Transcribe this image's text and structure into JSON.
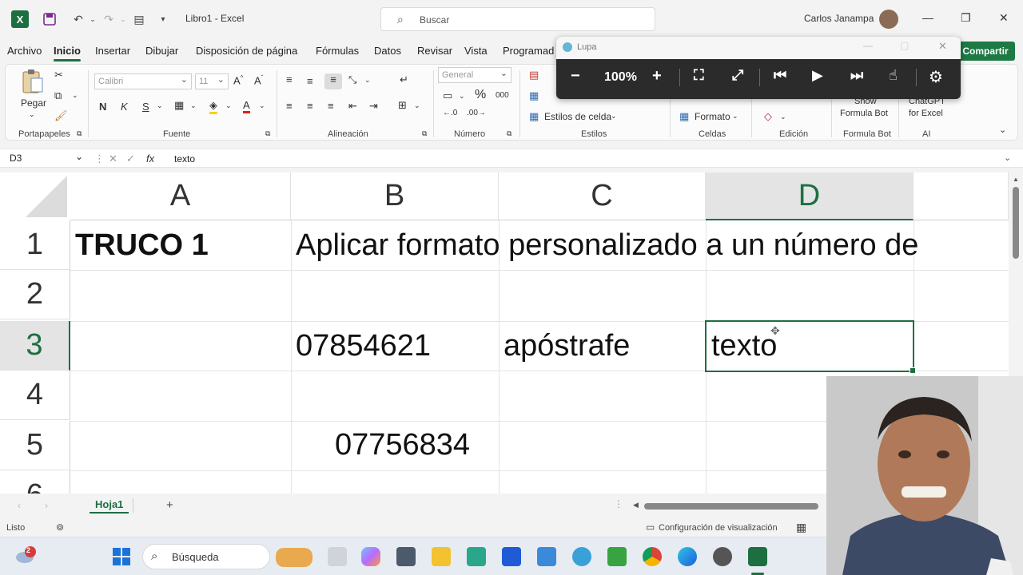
{
  "titlebar": {
    "doc_title": "Libro1  -  Excel",
    "search_placeholder": "Buscar",
    "user_name": "Carlos Janampa"
  },
  "menu": {
    "tabs": [
      "Archivo",
      "Inicio",
      "Insertar",
      "Dibujar",
      "Disposición de página",
      "Fórmulas",
      "Datos",
      "Revisar",
      "Vista",
      "Programad"
    ],
    "active": "Inicio",
    "share_label": "Compartir"
  },
  "ribbon": {
    "paste_label": "Pegar",
    "font_name": "Calibri",
    "font_size": "11",
    "bold": "N",
    "italic": "K",
    "underline": "S",
    "number_format": "General",
    "cell_styles": "Estilos de celda",
    "format_label": "Formato",
    "formula_bot_line1": "Show",
    "formula_bot_line2": "Formula Bot",
    "chatgpt_line1": "ChatGPT",
    "chatgpt_line2": "for Excel",
    "percent": "%",
    "thousands": "000",
    "groups": [
      "Portapapeles",
      "Fuente",
      "Alineación",
      "Número",
      "Estilos",
      "Celdas",
      "Edición",
      "Formula Bot",
      "AI"
    ]
  },
  "formula_bar": {
    "name_box": "D3",
    "fx": "fx",
    "content": "texto"
  },
  "grid": {
    "columns": [
      "A",
      "B",
      "C",
      "D"
    ],
    "rows": [
      "1",
      "2",
      "3",
      "4",
      "5",
      "6"
    ],
    "selected_column": "D",
    "selected_row": "3",
    "cells": {
      "A1": "TRUCO 1",
      "B1": "Aplicar formato personalizado a un número de",
      "B3": "07854621",
      "C3": "apóstrafe",
      "D3": "texto",
      "B5": "07756834"
    }
  },
  "sheets": {
    "tabs": [
      "Hoja1"
    ],
    "add": "+"
  },
  "status": {
    "ready": "Listo",
    "display_settings": "Configuración de visualización"
  },
  "magnifier": {
    "title": "Lupa",
    "zoom": "100%"
  },
  "taskbar": {
    "search_label": "Búsqueda",
    "notif_count": "2"
  }
}
